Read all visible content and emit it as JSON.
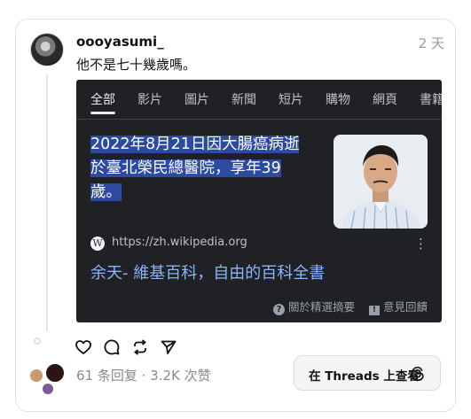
{
  "post": {
    "username": "oooyasumi_",
    "time": "2 天",
    "text": "他不是七十幾歲嗎。"
  },
  "embed": {
    "tabs": [
      "全部",
      "影片",
      "圖片",
      "新聞",
      "短片",
      "購物",
      "網頁",
      "書籍"
    ],
    "active_tab": "全部",
    "snippet_line1": "2022年8月21日因大腸癌病逝",
    "snippet_line2": "於臺北榮民總醫院，享年39",
    "snippet_line3": "歲。",
    "source_url": "https://zh.wikipedia.org",
    "wiki_letter": "W",
    "result_title": "余天- 維基百科，自由的百科全書",
    "footer_about": "關於精選摘要",
    "footer_feedback": "意見回饋",
    "kebab": "⋮"
  },
  "actions": [
    "heart-icon",
    "comment-icon",
    "repost-icon",
    "share-icon"
  ],
  "stats": {
    "text": "61 条回复 · 3.2K 次赞"
  },
  "threads_button": {
    "label": "在 Threads 上查看"
  },
  "colors": {
    "embed_bg": "#202124",
    "highlight": "#2b4aa0",
    "link_blue": "#8ab4f8"
  }
}
